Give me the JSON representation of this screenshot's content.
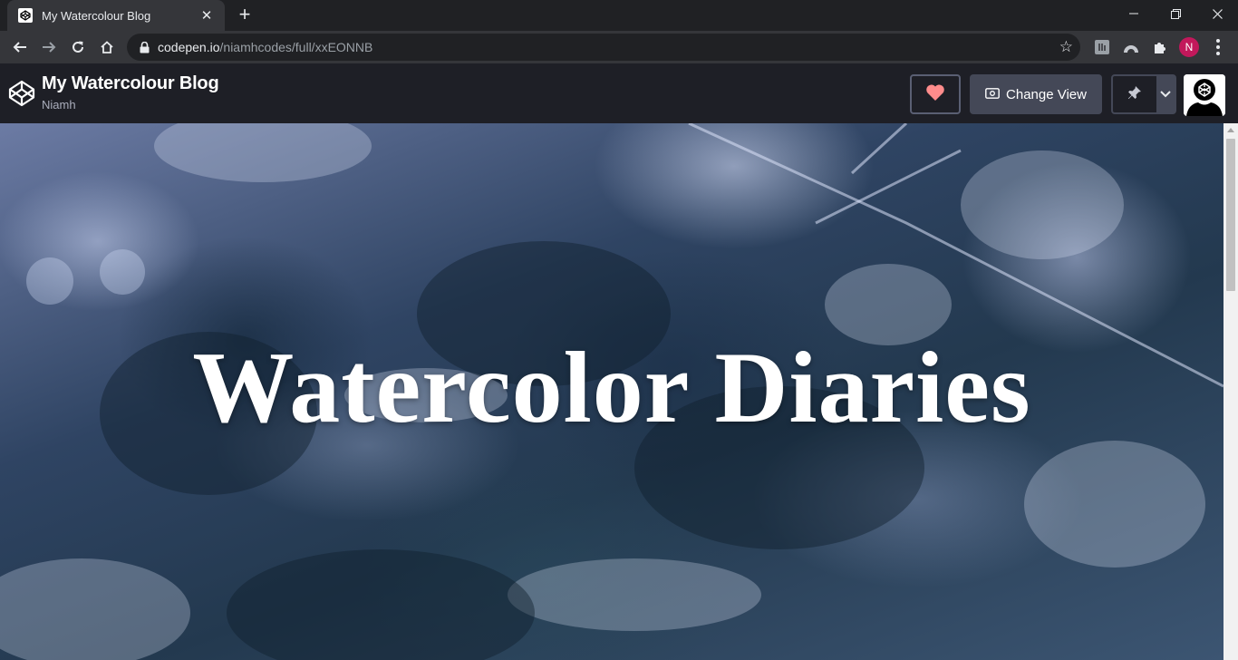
{
  "browser": {
    "tab_title": "My Watercolour Blog",
    "url_host": "codepen.io",
    "url_path": "/niamhcodes/full/xxEONNB",
    "profile_initial": "N"
  },
  "codepen": {
    "pen_title": "My Watercolour Blog",
    "author": "Niamh",
    "change_view_label": "Change View",
    "heart_color": "#ff8c8c",
    "accent_color": "#444857"
  },
  "page": {
    "hero_title": "Watercolor Diaries"
  }
}
